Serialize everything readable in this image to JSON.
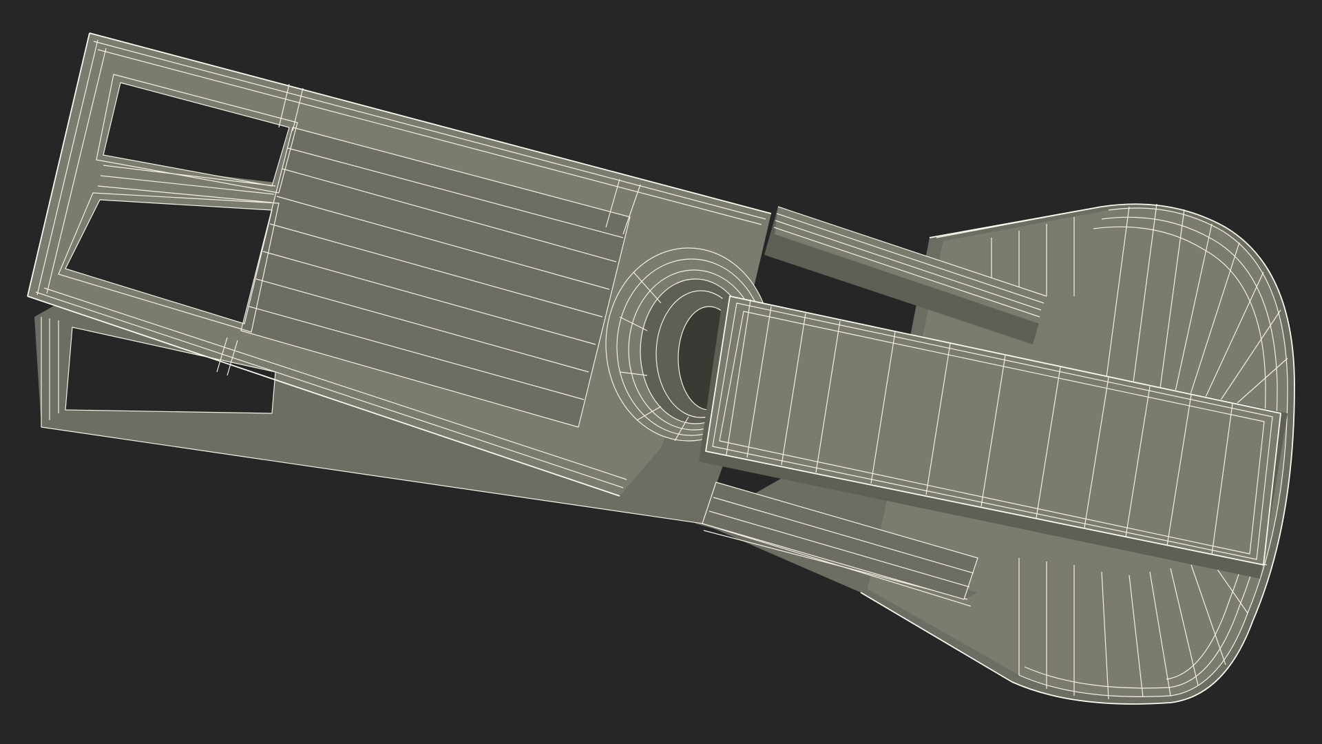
{
  "scene": {
    "background_color": "#262626",
    "model_color": "#7b7b70",
    "wireframe_color": "#f4f2e6",
    "subject": "zipper-slider-with-pull-tab"
  }
}
